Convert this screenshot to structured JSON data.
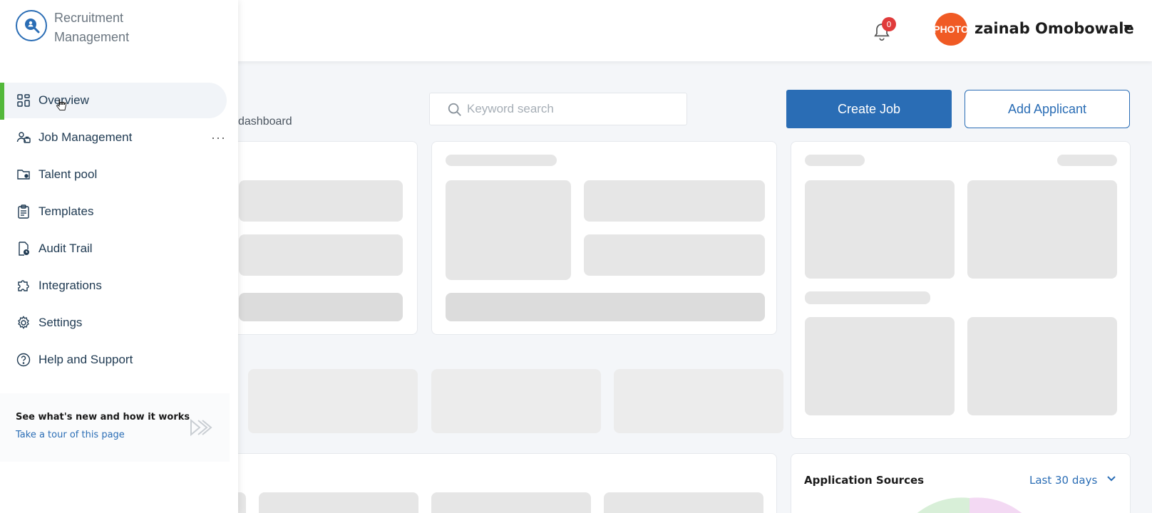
{
  "app": {
    "title": "Recruitment Management"
  },
  "header": {
    "notification_count": "0",
    "avatar_text": "PHOTO",
    "user_name": "zainab Omobowale"
  },
  "sidebar": {
    "items": [
      {
        "label": "Overview",
        "icon": "grid-icon",
        "active": true
      },
      {
        "label": "Job Management",
        "icon": "users-briefcase-icon"
      },
      {
        "label": "Talent pool",
        "icon": "folder-user-icon"
      },
      {
        "label": "Templates",
        "icon": "clipboard-icon"
      },
      {
        "label": "Audit Trail",
        "icon": "document-clock-icon"
      },
      {
        "label": "Integrations",
        "icon": "puzzle-icon"
      },
      {
        "label": "Settings",
        "icon": "gear-icon"
      },
      {
        "label": "Help and Support",
        "icon": "question-circle-icon"
      }
    ],
    "more_label": "···",
    "tour": {
      "title": "See what's new and how it works",
      "link": "Take a tour of this page"
    }
  },
  "main": {
    "breadcrumb_fragment": "dashboard",
    "search": {
      "placeholder": "Keyword search"
    },
    "create_job_label": "Create Job",
    "add_applicant_label": "Add Applicant",
    "application_sources": {
      "title": "Application Sources",
      "range": "Last 30 days"
    }
  },
  "colors": {
    "primary": "#2a6db5",
    "active_accent": "#53b83a",
    "badge": "#e03b3b",
    "avatar": "#f05a24"
  }
}
